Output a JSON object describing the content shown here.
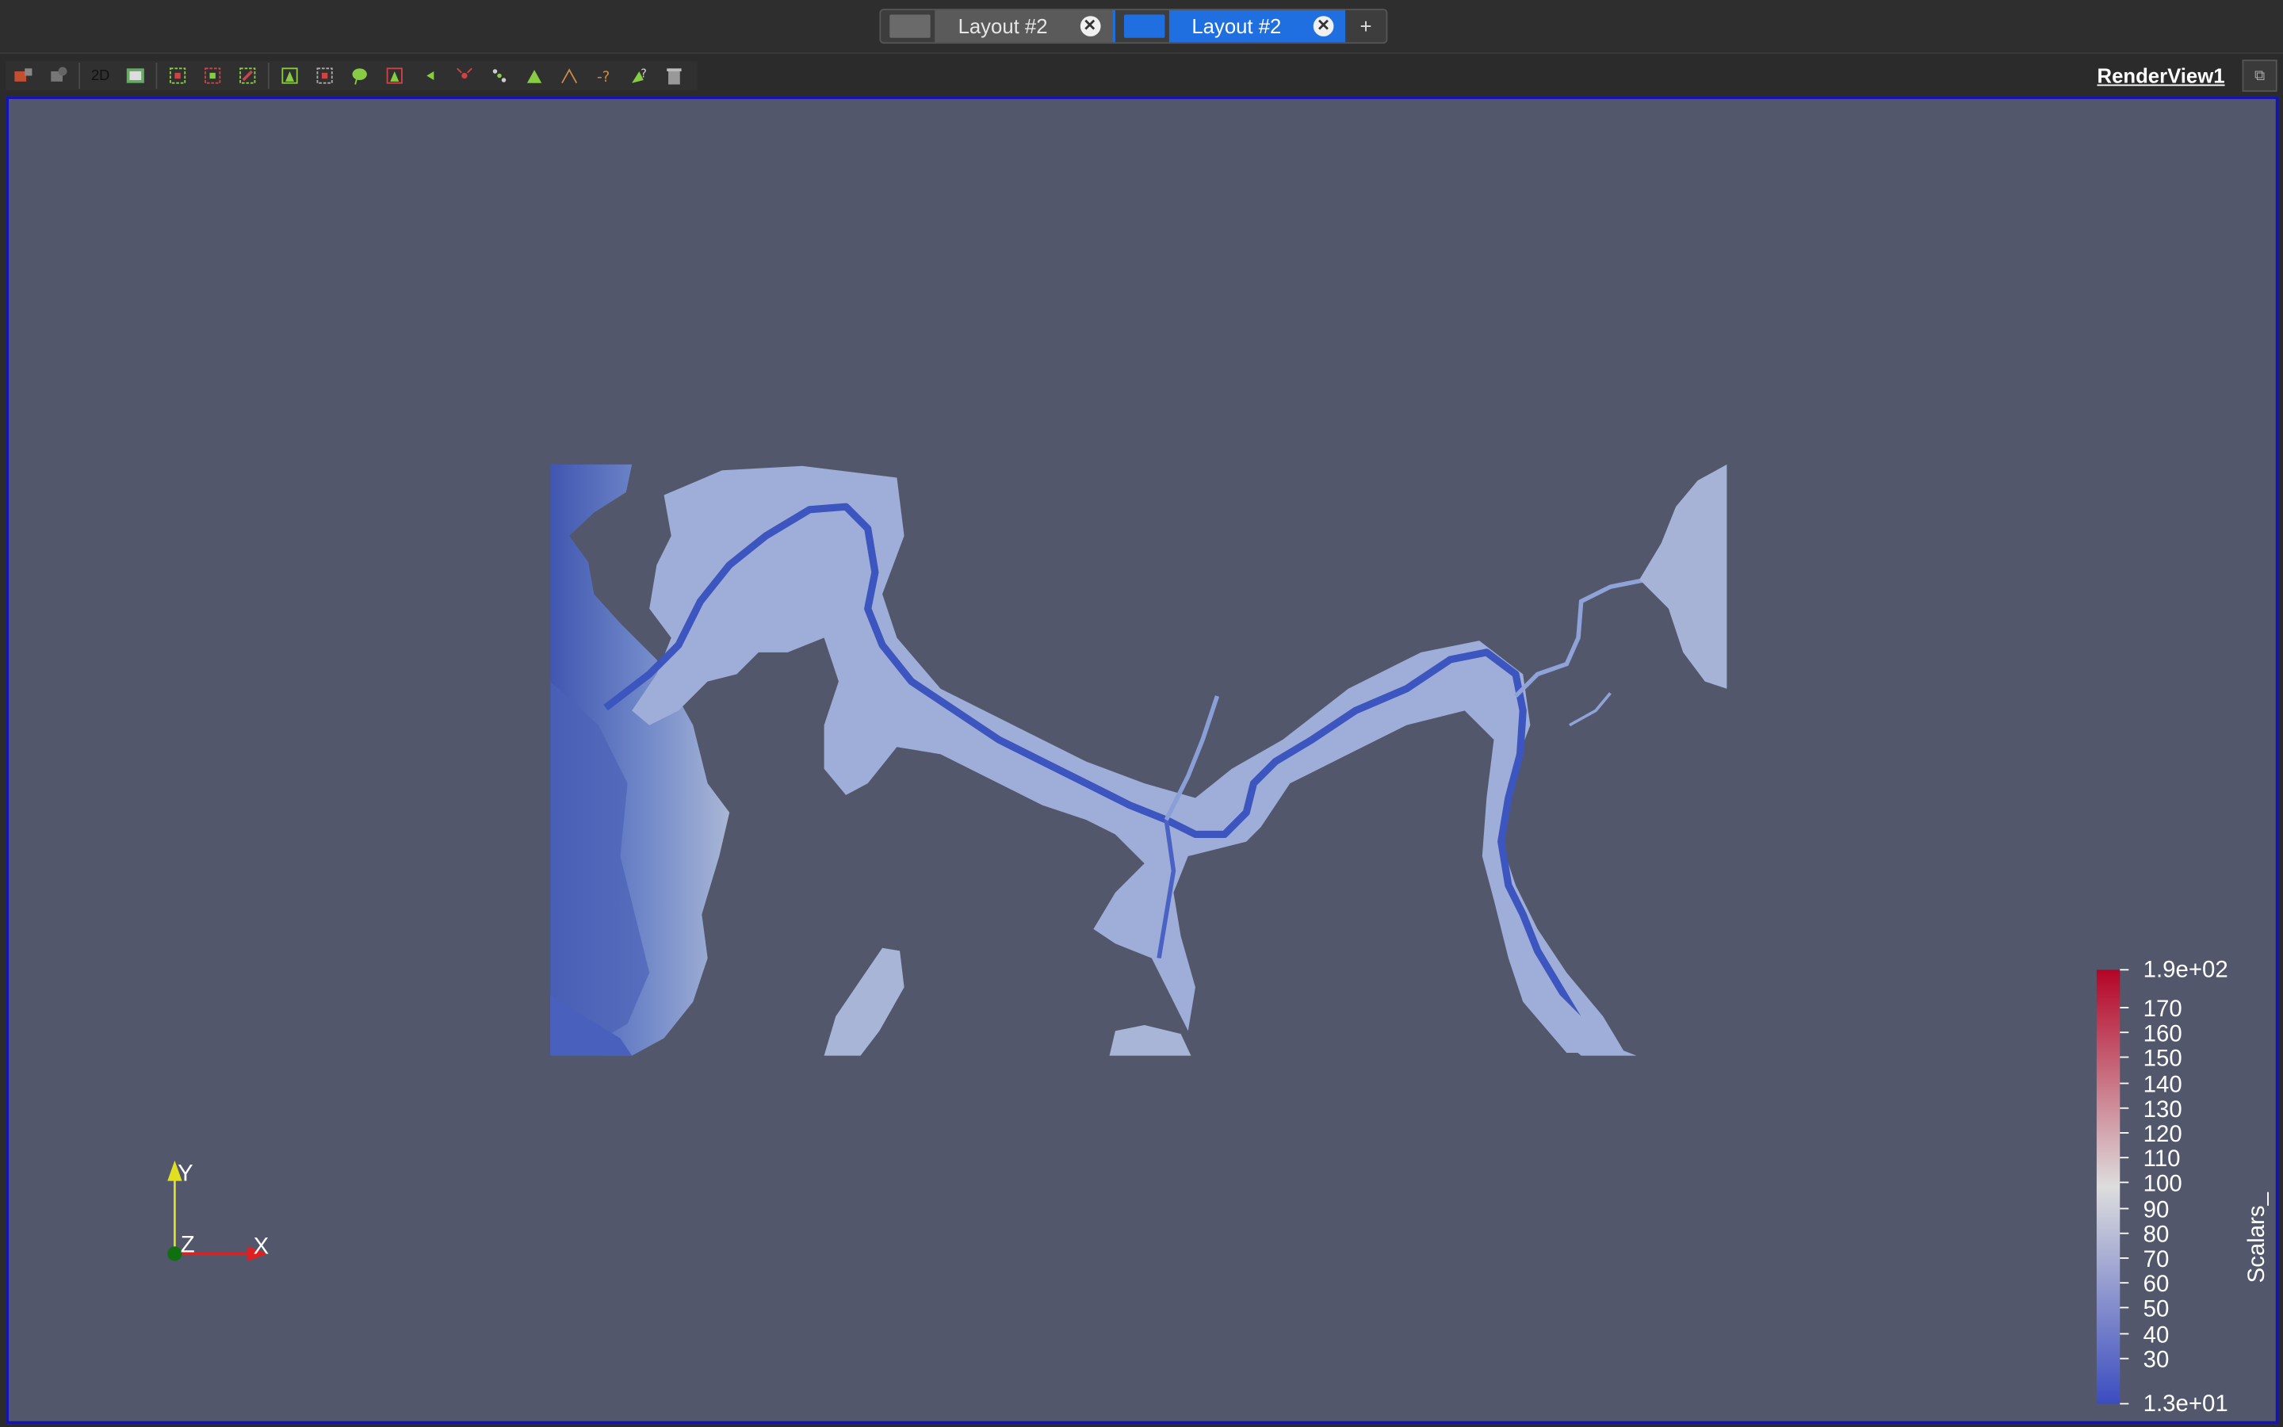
{
  "tabs": [
    {
      "label": "Layout #2",
      "close": "✕",
      "active": false
    },
    {
      "label": "Layout #2",
      "close": "✕",
      "active": true
    }
  ],
  "add_tab": "+",
  "toolbar": {
    "label_2d": "2D",
    "icons": [
      "reset-camera-icon",
      "zoom-to-data-icon",
      "toggle-2d-icon",
      "capture-icon",
      "select-cells-on-icon",
      "select-points-on-icon",
      "select-cells-frustum-icon",
      "select-points-frustum-icon",
      "select-block-icon",
      "interactive-select-icon",
      "hover-points-icon",
      "hover-cells-icon",
      "grow-selection-icon",
      "shrink-selection-icon",
      "clear-selection-icon"
    ]
  },
  "view": {
    "title": "RenderView1",
    "background": "#52576b",
    "border": "#1413b8"
  },
  "colorbar": {
    "title": "Scalars_",
    "top_label": "1.9e+02",
    "bottom_label": "1.3e+01",
    "ticks": [
      "170",
      "160",
      "150",
      "140",
      "130",
      "120",
      "110",
      "100",
      "90",
      "80",
      "70",
      "60",
      "50",
      "40",
      "30"
    ],
    "colors": {
      "high": "#b40426",
      "mid": "#dddddd",
      "low": "#3b4cc0"
    }
  },
  "axes": {
    "x": "X",
    "y": "Y",
    "z": "Z",
    "colors": {
      "x": "#e02020",
      "y": "#e0e020",
      "z": "#107010"
    }
  }
}
